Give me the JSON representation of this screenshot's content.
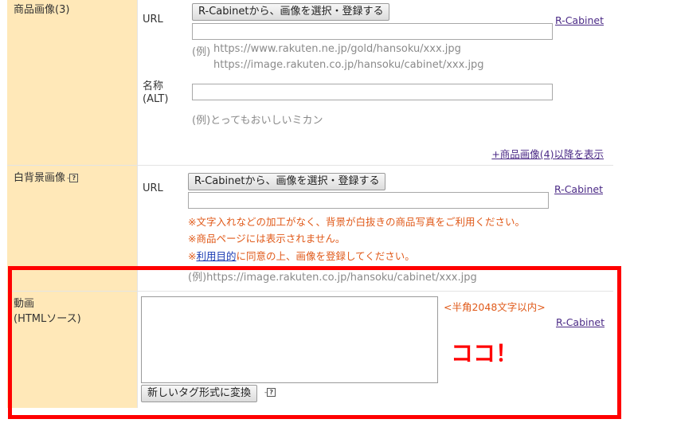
{
  "image3": {
    "label": "商品画像(3)",
    "url_label": "URL",
    "select_button": "R-Cabinetから、画像を選択・登録する",
    "url_value": "",
    "rcabinet_link": "R-Cabinet",
    "example_prefix": "(例)",
    "example_url_1": "https://www.rakuten.ne.jp/gold/hansoku/xxx.jpg",
    "example_url_2": "https://image.rakuten.co.jp/hansoku/cabinet/xxx.jpg",
    "alt_label_1": "名称",
    "alt_label_2": "(ALT)",
    "alt_value": "",
    "alt_example": "(例)とってもおいしいミカン",
    "show_more_link": "+商品画像(4)以降を表示"
  },
  "white_bg": {
    "label": "白背景画像",
    "help_icon": "help-question-icon",
    "url_label": "URL",
    "select_button": "R-Cabinetから、画像を選択・登録する",
    "url_value": "",
    "rcabinet_link": "R-Cabinet",
    "warning_1": "※文字入れなどの加工がなく、背景が白抜きの商品写真をご利用ください。",
    "warning_2": "※商品ページには表示されません。",
    "warning_3_prefix": "※",
    "usage_link": "利用目的",
    "warning_3_suffix": "に同意の上、画像を登録してください。",
    "example": "(例)https://image.rakuten.co.jp/hansoku/cabinet/xxx.jpg"
  },
  "video": {
    "label_1": "動画",
    "label_2": "(HTMLソース)",
    "textarea_value": "",
    "char_limit": "<半角2048文字以内>",
    "rcabinet_link": "R-Cabinet",
    "annotation": "ココ！",
    "convert_button": "新しいタグ形式に変換",
    "help_icon": "help-question-icon"
  },
  "colors": {
    "label_bg": "#ffe8b8",
    "highlight": "#ff0000",
    "warning": "#e05a1a"
  }
}
